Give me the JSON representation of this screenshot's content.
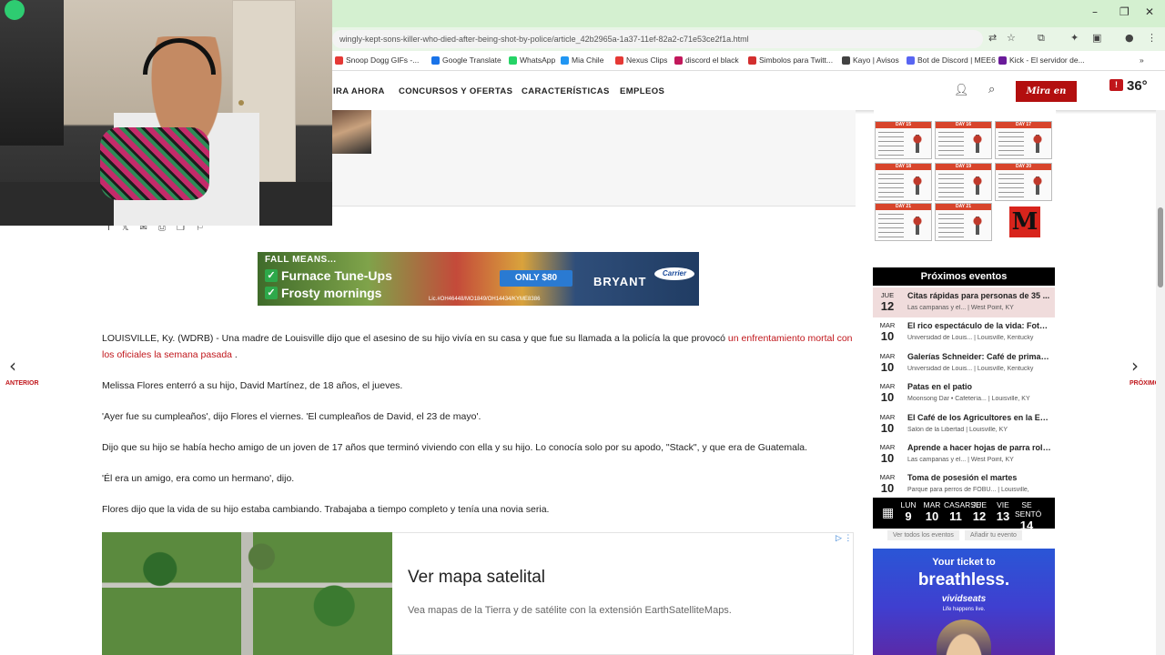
{
  "browser": {
    "url": "wingly-kept-sons-killer-who-died-after-being-shot-by-police/article_42b2965a-1a37-11ef-82a2-c71e53ce2f1a.html",
    "bookmarks": [
      {
        "label": "Snoop Dogg GIFs -...",
        "color": "#e53935"
      },
      {
        "label": "Google Translate",
        "color": "#1a73e8"
      },
      {
        "label": "WhatsApp",
        "color": "#25d366"
      },
      {
        "label": "Mia Chile",
        "color": "#2196f3"
      },
      {
        "label": "Nexus Clips",
        "color": "#e53935"
      },
      {
        "label": "discord el black",
        "color": "#c2185b"
      },
      {
        "label": "Simbolos para Twitt...",
        "color": "#d32f2f"
      },
      {
        "label": "Kayo | Avisos",
        "color": "#424242"
      },
      {
        "label": "Bot de Discord | MEE6",
        "color": "#5865f2"
      },
      {
        "label": "Kick - El servidor de...",
        "color": "#6a1b9a"
      }
    ]
  },
  "site_nav": {
    "items": [
      "IRA AHORA",
      "CONCURSOS Y OFERTAS",
      "CARACTERÍSTICAS",
      "EMPLEOS"
    ],
    "live_label": "Mira en vivo",
    "temperature": "36°",
    "alert": "!"
  },
  "ad_banner": {
    "headline": "FALL MEANS...",
    "line1": "Furnace Tune-Ups",
    "line2": "Frosty mornings",
    "offer": "ONLY $80",
    "brand": "BRYANT",
    "partner": "Carrier",
    "license": "Lic.#OH46448/MO1849/OH14434/KYME8386"
  },
  "article": {
    "p1_text": "LOUISVILLE, Ky. (WDRB) - Una madre de Louisville dijo que el asesino de su hijo vivía en su casa y que fue su llamada a la policía la que provocó ",
    "p1_link": "un enfrentamiento mortal con los oficiales la semana pasada",
    "p1_end": " .",
    "p2": "Melissa Flores enterró a su hijo, David Martínez, de 18 años, el jueves.",
    "p3": "'Ayer fue su cumpleaños', dijo Flores el viernes. 'El cumpleaños de David, el 23 de mayo'.",
    "p4": "Dijo que su hijo se había hecho amigo de un joven de 17 años que terminó viviendo con ella y su hijo. Lo conocía solo por su apodo, \"Stack\", y que era de Guatemala.",
    "p5": "'Él era un amigo, era como un hermano', dijo.",
    "p6": "Flores dijo que la vida de su hijo estaba cambiando. Trabajaba a tiempo completo y tenía una novia seria."
  },
  "sat_ad": {
    "title": "Ver mapa satelital",
    "description": "Vea mapas de la Tierra y de satélite con la extensión EarthSatelliteMaps.",
    "adchoice": "▷ ⋮"
  },
  "nav_arrows": {
    "prev_label": "ANTERIOR",
    "next_label": "PRÓXIMO"
  },
  "workout": {
    "days": [
      "DAY 15",
      "DAY 16",
      "DAY 17",
      "DAY 18",
      "DAY 19",
      "DAY 20",
      "DAY 21",
      "DAY 21"
    ]
  },
  "events": {
    "heading": "Próximos eventos",
    "items": [
      {
        "month": "JUE",
        "day": "12",
        "title": "Citas rápidas para personas de 35 ...",
        "location": "Las campanas y el... | West Point, KY",
        "highlight": true
      },
      {
        "month": "MAR",
        "day": "10",
        "title": "El rico espectáculo de la vida: Foto...",
        "location": "Universidad de Louis... | Louisville, Kentucky"
      },
      {
        "month": "MAR",
        "day": "10",
        "title": "Galerías Schneider: Café de primav...",
        "location": "Universidad de Louis... | Louisville, Kentucky"
      },
      {
        "month": "MAR",
        "day": "10",
        "title": "Patas en el patio",
        "location": "Moonsong Dar • Cafetería... | Louisville, KY"
      },
      {
        "month": "MAR",
        "day": "10",
        "title": "El Café de los Agricultores en la Ex...",
        "location": "Salón de la Libertad | Louisville, KY"
      },
      {
        "month": "MAR",
        "day": "10",
        "title": "Aprende a hacer hojas de parra roll...",
        "location": "Las campanas y el... | West Point, KY"
      },
      {
        "month": "MAR",
        "day": "10",
        "title": "Toma de posesión el martes",
        "location": "Parque para perros de FOBU... | Louisville,"
      }
    ],
    "week": [
      {
        "name": "LUN",
        "day": "9"
      },
      {
        "name": "MAR",
        "day": "10"
      },
      {
        "name": "CASARSE",
        "day": "11"
      },
      {
        "name": "JUE",
        "day": "12"
      },
      {
        "name": "VIE",
        "day": "13"
      },
      {
        "name": "SE SENTÓ",
        "day": "14"
      }
    ],
    "view_all": "Ver todos los eventos",
    "add_event": "Añadir tu evento"
  },
  "ticket_ad": {
    "line1": "Your ticket to",
    "line2": "breathless.",
    "brand": "vividseats",
    "tagline": "Life happens live."
  }
}
